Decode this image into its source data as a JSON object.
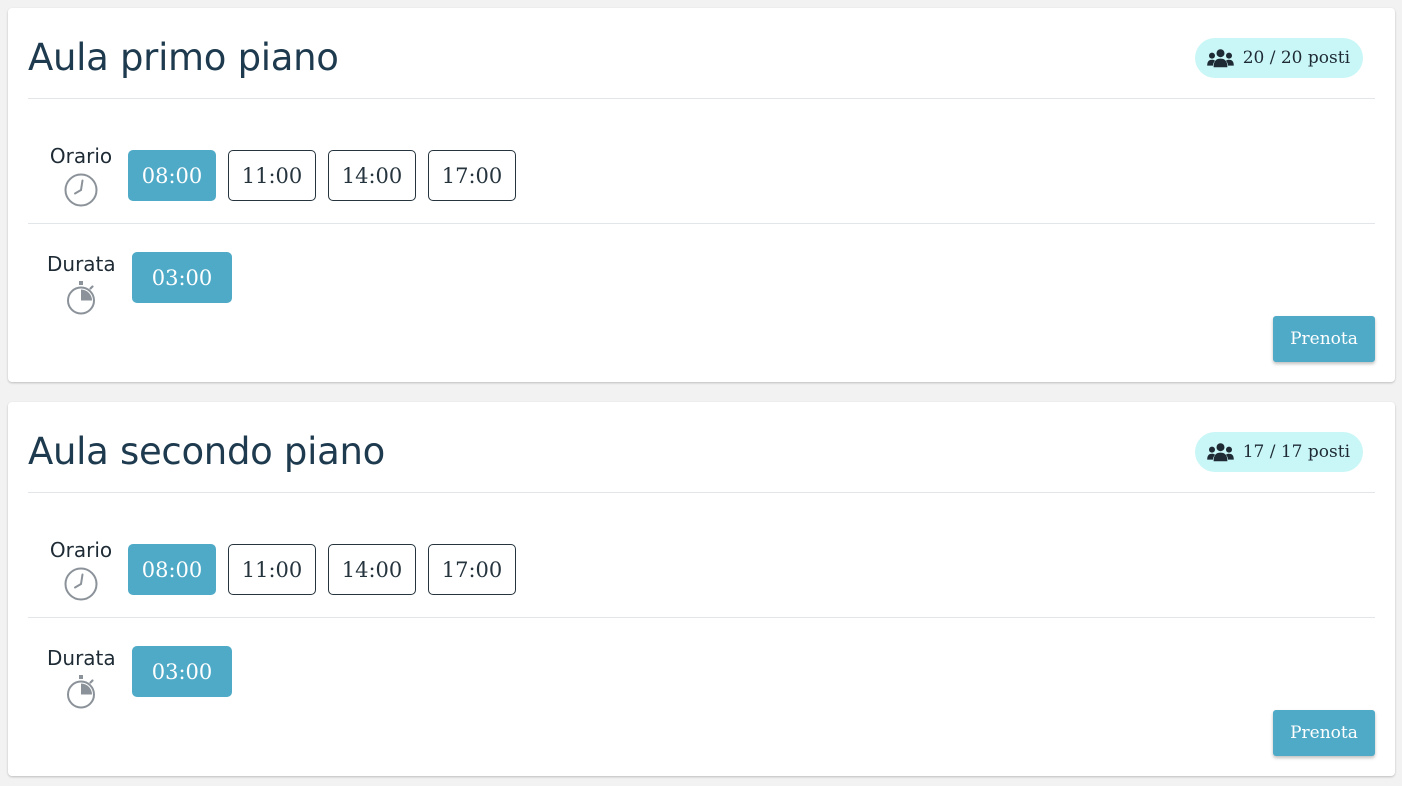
{
  "rooms": [
    {
      "title": "Aula primo piano",
      "seats": "20 / 20 posti",
      "time_label": "Orario",
      "times": [
        "08:00",
        "11:00",
        "14:00",
        "17:00"
      ],
      "selected_time": "08:00",
      "duration_label": "Durata",
      "durations": [
        "03:00"
      ],
      "selected_duration": "03:00",
      "book_label": "Prenota"
    },
    {
      "title": "Aula secondo piano",
      "seats": "17 / 17 posti",
      "time_label": "Orario",
      "times": [
        "08:00",
        "11:00",
        "14:00",
        "17:00"
      ],
      "selected_time": "08:00",
      "duration_label": "Durata",
      "durations": [
        "03:00"
      ],
      "selected_duration": "03:00",
      "book_label": "Prenota"
    }
  ],
  "colors": {
    "accent": "#4faac7",
    "badge_bg": "#c9f6f6",
    "title_text": "#1e3a4e",
    "chip_border": "#26343e",
    "page_bg": "#f2f2f2"
  },
  "icons": {
    "seats": "users-icon",
    "time": "clock-icon",
    "duration": "stopwatch-icon"
  }
}
